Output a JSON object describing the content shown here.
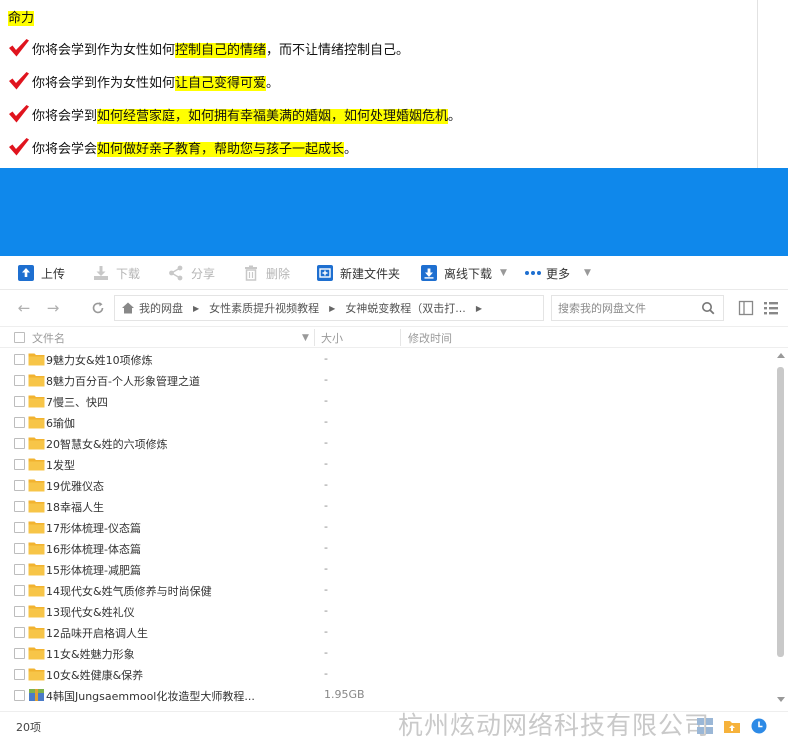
{
  "document": {
    "lines": [
      {
        "id": "intro",
        "segments": [
          {
            "text": "命力",
            "highlight": true
          }
        ]
      },
      {
        "id": "b1",
        "check": true,
        "segments": [
          {
            "text": "你将会学到作为女性如何",
            "highlight": false
          },
          {
            "text": "控制自己的情绪",
            "highlight": true
          },
          {
            "text": "，而不让情绪控制自己。",
            "highlight": false
          }
        ]
      },
      {
        "id": "b2",
        "check": true,
        "segments": [
          {
            "text": "你将会学到作为女性如何",
            "highlight": false
          },
          {
            "text": "让自己变得可爱",
            "highlight": true
          },
          {
            "text": "。",
            "highlight": false
          }
        ]
      },
      {
        "id": "b3",
        "check": true,
        "segments": [
          {
            "text": "你将会学到",
            "highlight": false
          },
          {
            "text": "如何经营家庭，如何拥有幸福美满的婚姻，如何处理婚姻危机",
            "highlight": true
          },
          {
            "text": "。",
            "highlight": false
          }
        ]
      },
      {
        "id": "b4",
        "check": true,
        "segments": [
          {
            "text": "你将会学会",
            "highlight": false
          },
          {
            "text": "如何做好亲子教育，帮助您与孩子一起成长",
            "highlight": true
          },
          {
            "text": "。",
            "highlight": false
          }
        ]
      }
    ],
    "check_icon": "checkmark-icon",
    "highlight_color": "#ffff00",
    "check_color": "#e0141e"
  },
  "band_color": "#0f88eb",
  "toolbar": {
    "upload": {
      "label": "上传",
      "icon": "upload-icon",
      "enabled": true
    },
    "download": {
      "label": "下载",
      "icon": "download-icon",
      "enabled": false
    },
    "share": {
      "label": "分享",
      "icon": "share-icon",
      "enabled": false
    },
    "delete": {
      "label": "删除",
      "icon": "trash-icon",
      "enabled": false
    },
    "new_folder": {
      "label": "新建文件夹",
      "icon": "new-folder-icon",
      "enabled": true
    },
    "offline": {
      "label": "离线下载",
      "icon": "offline-download-icon",
      "enabled": true
    },
    "more": {
      "label": "更多",
      "icon": "more-dots-icon",
      "enabled": true
    },
    "accent": "#1e6fd0"
  },
  "nav": {
    "breadcrumb": [
      "我的网盘",
      "女性素质提升视频教程",
      "女神蜕变教程（双击打..."
    ],
    "search_placeholder": "搜索我的网盘文件"
  },
  "columns": {
    "name": "文件名",
    "size": "大小",
    "modified": "修改时间"
  },
  "files": [
    {
      "name": "9魅力女&姓10项修炼",
      "size": "-",
      "type": "folder"
    },
    {
      "name": "8魅力百分百-个人形象管理之道",
      "size": "-",
      "type": "folder"
    },
    {
      "name": "7慢三、快四",
      "size": "-",
      "type": "folder"
    },
    {
      "name": "6瑜伽",
      "size": "-",
      "type": "folder"
    },
    {
      "name": "20智慧女&姓的六项修炼",
      "size": "-",
      "type": "folder"
    },
    {
      "name": "1发型",
      "size": "-",
      "type": "folder"
    },
    {
      "name": "19优雅仪态",
      "size": "-",
      "type": "folder"
    },
    {
      "name": "18幸福人生",
      "size": "-",
      "type": "folder"
    },
    {
      "name": "17形体梳理-仪态篇",
      "size": "-",
      "type": "folder"
    },
    {
      "name": "16形体梳理-体态篇",
      "size": "-",
      "type": "folder"
    },
    {
      "name": "15形体梳理-减肥篇",
      "size": "-",
      "type": "folder"
    },
    {
      "name": "14现代女&姓气质修养与时尚保健",
      "size": "-",
      "type": "folder"
    },
    {
      "name": "13现代女&姓礼仪",
      "size": "-",
      "type": "folder"
    },
    {
      "name": "12品味开启格调人生",
      "size": "-",
      "type": "folder"
    },
    {
      "name": "11女&姓魅力形象",
      "size": "-",
      "type": "folder"
    },
    {
      "name": "10女&姓健康&保养",
      "size": "-",
      "type": "folder"
    },
    {
      "name": "4韩国Jungsaemmool化妆造型大师教程...",
      "size": "1.95GB",
      "type": "archive"
    }
  ],
  "status": {
    "count": "20项"
  },
  "watermark": "杭州炫动网络科技有限公司"
}
